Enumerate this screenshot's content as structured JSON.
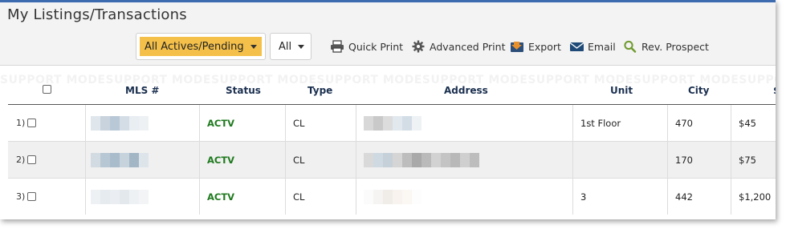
{
  "page": {
    "title": "My Listings/Transactions"
  },
  "toolbar": {
    "filter_value": "All Actives/Pending",
    "type_value": "All",
    "actions": [
      {
        "label": "Quick Print",
        "icon": "printer-icon"
      },
      {
        "label": "Advanced Print",
        "icon": "gear-icon"
      },
      {
        "label": "Export",
        "icon": "export-icon"
      },
      {
        "label": "Email",
        "icon": "envelope-icon"
      },
      {
        "label": "Rev. Prospect",
        "icon": "magnifier-icon"
      }
    ]
  },
  "watermark": "SUPPORT MODE",
  "table": {
    "columns": [
      "MLS #",
      "Status",
      "Type",
      "Address",
      "Unit",
      "City",
      "$"
    ],
    "rows": [
      {
        "num": "1)",
        "status": "ACTV",
        "type": "CL",
        "unit": "1st Floor",
        "city": "470",
        "price": "$45"
      },
      {
        "num": "2)",
        "status": "ACTV",
        "type": "CL",
        "unit": "",
        "city": "170",
        "price": "$75"
      },
      {
        "num": "3)",
        "status": "ACTV",
        "type": "CL",
        "unit": "3",
        "city": "442",
        "price": "$1,200"
      }
    ]
  },
  "colors": {
    "accent_bar": "#3d6bb0",
    "filter_highlight": "#f4c04a",
    "status_active": "#1f7a1f",
    "header_text": "#1a2f4f"
  }
}
